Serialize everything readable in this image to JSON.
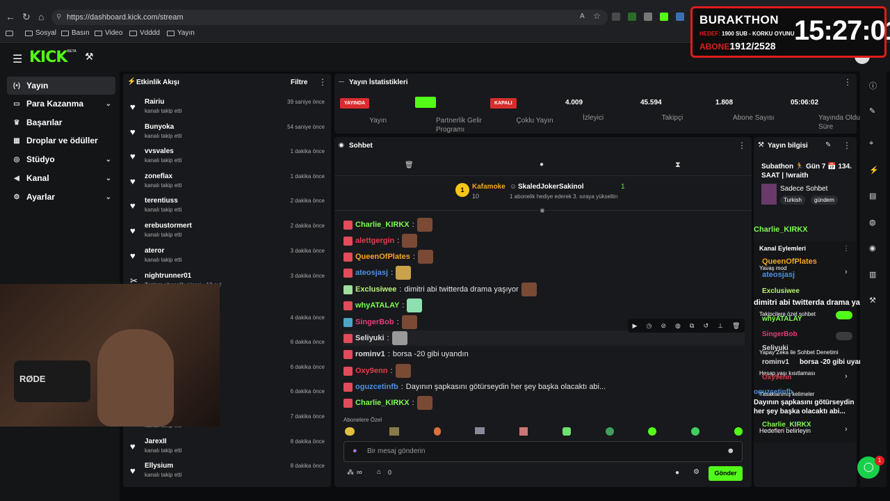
{
  "browser": {
    "url": "https://dashboard.kick.com/stream",
    "bookmarks": [
      "Sosyal",
      "Basın",
      "Video",
      "Vdddd",
      "Yayın"
    ]
  },
  "overlay": {
    "name": "BURAKTHON",
    "hedef_label": "HEDEF:",
    "hedef_text": "1900 SUB - KORKU OYUNU",
    "abone_label": "ABONE",
    "abone_value": "1912/2528",
    "clock": "15:27:01"
  },
  "header": {
    "logo": "KICK",
    "beta": "BETA"
  },
  "sidebar": {
    "items": [
      {
        "label": "Yayın",
        "icon": "broadcast-icon",
        "active": true,
        "chevron": false
      },
      {
        "label": "Para Kazanma",
        "icon": "money-icon",
        "chevron": true
      },
      {
        "label": "Başarılar",
        "icon": "trophy-icon",
        "chevron": false
      },
      {
        "label": "Droplar ve ödüller",
        "icon": "gift-icon",
        "chevron": false
      },
      {
        "label": "Stüdyo",
        "icon": "studio-icon",
        "chevron": true
      },
      {
        "label": "Kanal",
        "icon": "megaphone-icon",
        "chevron": true
      },
      {
        "label": "Ayarlar",
        "icon": "gear-icon",
        "chevron": true
      }
    ]
  },
  "activity": {
    "title": "Etkinlik Akışı",
    "filter": "Filtre",
    "items": [
      {
        "name": "Rairiu",
        "sub": "kanalı takip etti",
        "time": "39 saniye önce"
      },
      {
        "name": "Bunyoka",
        "sub": "kanalı takip etti",
        "time": "54 saniye önce"
      },
      {
        "name": "vvsvales",
        "sub": "kanalı takip etti",
        "time": "1 dakika önce"
      },
      {
        "name": "zoneflax",
        "sub": "kanalı takip etti",
        "time": "1 dakika önce"
      },
      {
        "name": "terentiuss",
        "sub": "kanalı takip etti",
        "time": "2 dakika önce"
      },
      {
        "name": "erebustormert",
        "sub": "kanalı takip etti",
        "time": "2 dakika önce"
      },
      {
        "name": "ateror",
        "sub": "kanalı takip etti",
        "time": "3 dakika önce"
      },
      {
        "name": "nightrunner01",
        "sub": "Toplam abonelik süresi - 13 ay!",
        "time": "3 dakika önce"
      },
      {
        "name": "",
        "sub": "",
        "time": "4 dakika önce"
      },
      {
        "name": "",
        "sub": "",
        "time": "6 dakika önce"
      },
      {
        "name": "",
        "sub": "",
        "time": "6 dakika önce"
      },
      {
        "name": "",
        "sub": "",
        "time": "6 dakika önce"
      },
      {
        "name": "",
        "sub": "kanalı takip etti",
        "time": "7 dakika önce"
      },
      {
        "name": "JarexII",
        "sub": "kanalı takip etti",
        "time": "8 dakika önce"
      },
      {
        "name": "Ellysium",
        "sub": "kanalı takip etti",
        "time": "8 dakika önce"
      }
    ]
  },
  "stats": {
    "title": "Yayın İstatistikleri",
    "items": [
      {
        "badge": "YAYINDA",
        "badge_kind": "red",
        "label": "Yayın"
      },
      {
        "badge": "",
        "badge_kind": "green",
        "label": "Partnerlik Gelir Programı"
      },
      {
        "badge": "KAPALI",
        "badge_kind": "red",
        "label": "Çoklu Yayın"
      },
      {
        "value": "4.009",
        "label": "İzleyici"
      },
      {
        "value": "45.594",
        "label": "Takipçi"
      },
      {
        "value": "1.808",
        "label": "Abone Sayısı"
      },
      {
        "value": "05:06:02",
        "label": "Yayında Olduğu Süre"
      }
    ]
  },
  "chat": {
    "title": "Sohbet",
    "pinned": {
      "rank": "1",
      "user": "Kafamoke",
      "count": "10",
      "gifter": "SkaledJokerSakinol",
      "gift_count": "1",
      "gift_text": "1 abonelik hediye ederek 3. sıraya yükseltin"
    },
    "messages": [
      {
        "user": "Charlie_KIRKX",
        "color": "#7cfc50",
        "text": "",
        "emote": true
      },
      {
        "user": "alettgergin",
        "color": "#e83a4a",
        "text": "",
        "emote": true
      },
      {
        "user": "QueenOfPlates",
        "color": "#f5a623",
        "text": "",
        "emote": true
      },
      {
        "user": "ateosjasj",
        "color": "#4a90e2",
        "text": "",
        "emote": true
      },
      {
        "user": "Exclusiwee",
        "color": "#b8f07a",
        "text": "dimitri abi twitterda drama yaşıyor",
        "emote": true
      },
      {
        "user": "whyATALAY",
        "color": "#7cfc50",
        "text": "",
        "emote": true
      },
      {
        "user": "SingerBob",
        "color": "#e83a7a",
        "text": "",
        "emote": true
      },
      {
        "user": "Seliyuki",
        "color": "#dddddd",
        "text": "",
        "emote": true
      },
      {
        "user": "rominv1",
        "color": "#dddddd",
        "text": "borsa -20 gibi uyandın",
        "emote": false
      },
      {
        "user": "Oxy9enn",
        "color": "#e83a4a",
        "text": "",
        "emote": true
      },
      {
        "user": "oguzcetinfb",
        "color": "#4a90e2",
        "text": "Dayının şapkasını götürseydin her şey başka olacaktı abi...",
        "emote": false
      },
      {
        "user": "Charlie_KIRKX",
        "color": "#7cfc50",
        "text": "",
        "emote": true
      }
    ],
    "emote_section": "Abonelere Özel",
    "input_placeholder": "Bir mesaj gönderin",
    "infinity_count": "∞",
    "store_count": "0",
    "send_label": "Gönder"
  },
  "info": {
    "title": "Yayın bilgisi",
    "stream_title": "Subathon 🏃 Gün 7 📅 134. SAAT | !wraith",
    "category": "Sadece Sohbet",
    "tags": [
      "Turkish",
      "gündem"
    ],
    "mod_title": "Kanal Eylemleri",
    "mod_items": [
      "Yavaş mod",
      "Takipçilere özel sohbet",
      "Yapay Zeka ile Sohbet Denetimi",
      "Hesap yaşı kısıtlaması",
      "Yasaklanmış kelimeler"
    ],
    "goals": "Hedefleri belirleyin",
    "overlay_messages": [
      {
        "user": "Charlie_KIRKX",
        "text": ""
      },
      {
        "user": "QueenOfPlates",
        "text": ""
      },
      {
        "user": "ateosjasj",
        "text": ""
      },
      {
        "user": "Exclusiwee",
        "text": "dimitri abi twitterda drama yaşıyor"
      },
      {
        "user": "whyATALAY",
        "text": ""
      },
      {
        "user": "SingerBob",
        "text": ""
      },
      {
        "user": "Seliyuki",
        "text": ""
      },
      {
        "user": "rominv1",
        "text": "borsa -20 gibi uyandın"
      },
      {
        "user": "Oxy9enn",
        "text": ""
      },
      {
        "user": "oguzcetinfb",
        "text": "Dayının şapkasını götürseydin her şey başka olacaktı abi..."
      },
      {
        "user": "Charlie_KIRKX",
        "text": ""
      }
    ]
  },
  "webcam": {
    "mic_brand": "RØDE"
  },
  "notifications": {
    "count": "1"
  }
}
